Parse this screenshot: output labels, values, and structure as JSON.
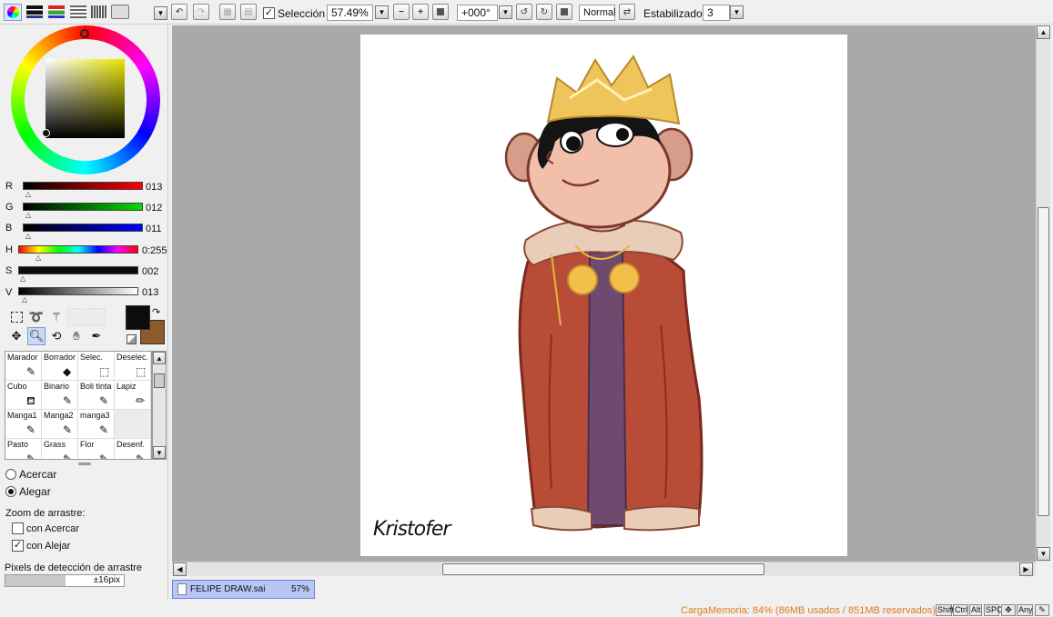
{
  "toolbar": {
    "selection_label": "Selección",
    "selection_checked": true,
    "zoom_value": "57.49%",
    "rotation_value": "+000°",
    "blend_mode": "Normal",
    "stabilizer_label": "Estabilizador",
    "stabilizer_value": "3"
  },
  "color": {
    "sliders": [
      {
        "label": "R",
        "value": "013"
      },
      {
        "label": "G",
        "value": "012"
      },
      {
        "label": "B",
        "value": "011"
      },
      {
        "label": "H",
        "value": "0:255"
      },
      {
        "label": "S",
        "value": "002"
      },
      {
        "label": "V",
        "value": "013"
      }
    ],
    "primary": "#0d0c0b",
    "secondary": "#8e5a2c"
  },
  "brushes": [
    [
      "Marador",
      "Borrador",
      "Selec.",
      "Deselec."
    ],
    [
      "Cubo",
      "Binario",
      "Boli tinta",
      "Lapiz"
    ],
    [
      "Manga1",
      "Manga2",
      "manga3",
      ""
    ],
    [
      "Pasto",
      "Grass",
      "Flor",
      "Desenf."
    ]
  ],
  "zoom_options": {
    "zoom_in_label": "Acercar",
    "zoom_out_label": "Alegar",
    "drag_zoom_label": "Zoom de arrastre:",
    "drag_zoom_in_label": "con Acercar",
    "drag_zoom_out_label": "con Alejar",
    "drag_pixels_label": "Pixels de detección de arrastre",
    "drag_pixels_value": "±16pix"
  },
  "canvas": {
    "signature": "Kristofer"
  },
  "document_tab": {
    "name": "FELIPE DRAW.sai",
    "zoom": "57%"
  },
  "status": {
    "memory": "CargaMemoria: 84% (86MB usados / 851MB reservados)",
    "keys": [
      "Shift",
      "Ctrl",
      "Alt",
      "SPC",
      "Any"
    ]
  }
}
